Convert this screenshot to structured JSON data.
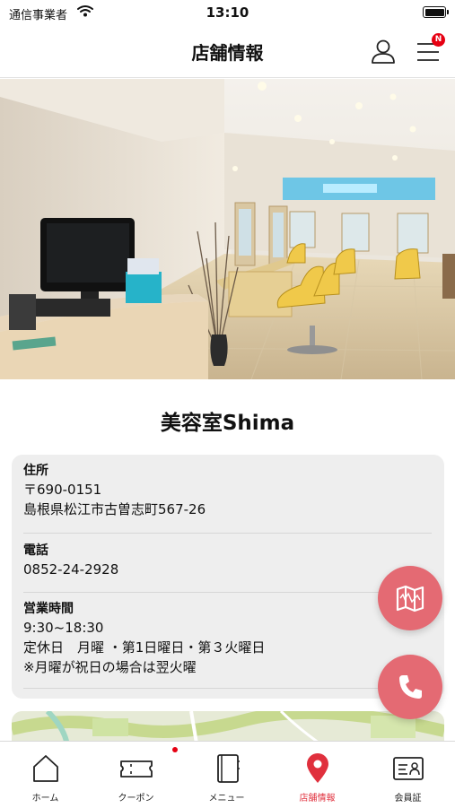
{
  "status_bar": {
    "carrier": "通信事業者",
    "time": "13:10"
  },
  "header": {
    "title": "店舗情報",
    "menu_badge": "N"
  },
  "shop": {
    "name": "美容室Shima"
  },
  "info": {
    "address": {
      "label": "住所",
      "postal": "〒690-0151",
      "line": "島根県松江市古曽志町567-26"
    },
    "phone": {
      "label": "電話",
      "value": "0852-24-2928"
    },
    "hours": {
      "label": "営業時間",
      "time": "9:30~18:30",
      "closed": "定休日　月曜 ・第1日曜日・第３火曜日",
      "note": "※月曜が祝日の場合は翌火曜"
    }
  },
  "tabs": [
    {
      "label": "ホーム",
      "icon": "home-icon"
    },
    {
      "label": "クーポン",
      "icon": "coupon-icon"
    },
    {
      "label": "メニュー",
      "icon": "menu-book-icon"
    },
    {
      "label": "店舗情報",
      "icon": "location-pin-icon"
    },
    {
      "label": "会員証",
      "icon": "member-card-icon"
    }
  ],
  "colors": {
    "accent": "#e0303d",
    "fab": "#e46a73",
    "badge": "#e60012",
    "card": "#eeeeee"
  }
}
